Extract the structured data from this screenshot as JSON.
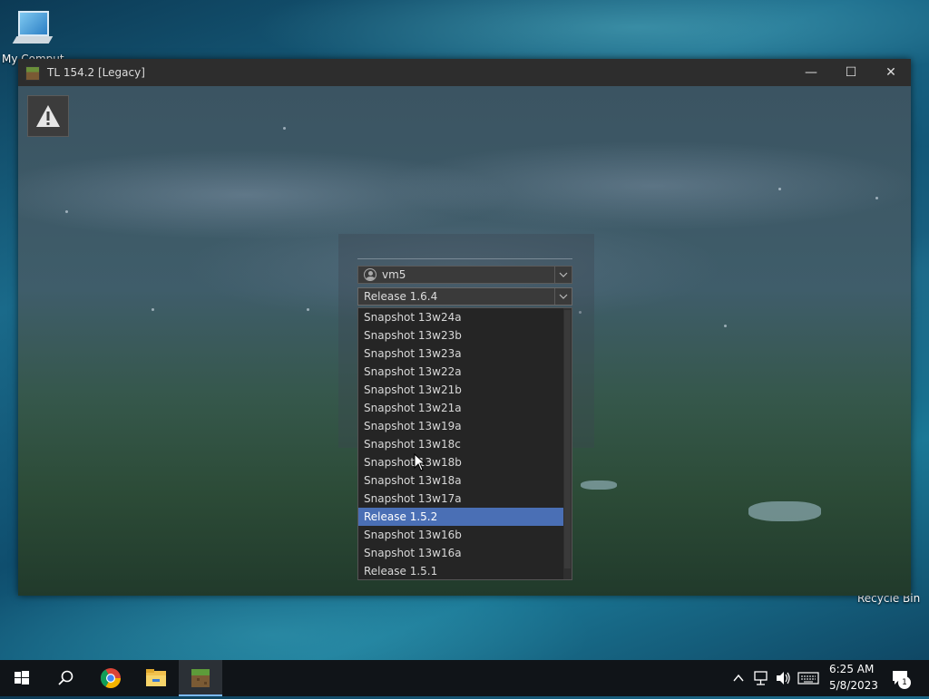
{
  "desktop": {
    "icons": [
      {
        "label": "My Comput..."
      },
      {
        "label": "Recycle Bin"
      }
    ]
  },
  "window": {
    "title": "TL 154.2 [Legacy]",
    "controls": {
      "minimize": "—",
      "maximize": "☐",
      "close": "✕"
    }
  },
  "launcher": {
    "account": {
      "selected": "vm5"
    },
    "version": {
      "selected": "Release 1.6.4",
      "options": [
        "Snapshot 13w24a",
        "Snapshot 13w23b",
        "Snapshot 13w23a",
        "Snapshot 13w22a",
        "Snapshot 13w21b",
        "Snapshot 13w21a",
        "Snapshot 13w19a",
        "Snapshot 13w18c",
        "Snapshot 13w18b",
        "Snapshot 13w18a",
        "Snapshot 13w17a",
        "Release 1.5.2",
        "Snapshot 13w16b",
        "Snapshot 13w16a",
        "Release 1.5.1"
      ],
      "highlighted_index": 11
    }
  },
  "taskbar": {
    "clock": {
      "time": "6:25 AM",
      "date": "5/8/2023"
    },
    "notification_count": "1"
  },
  "colors": {
    "selection": "#4a6fb5",
    "taskbar": "#101418",
    "titlebar": "#2d2d2d"
  }
}
